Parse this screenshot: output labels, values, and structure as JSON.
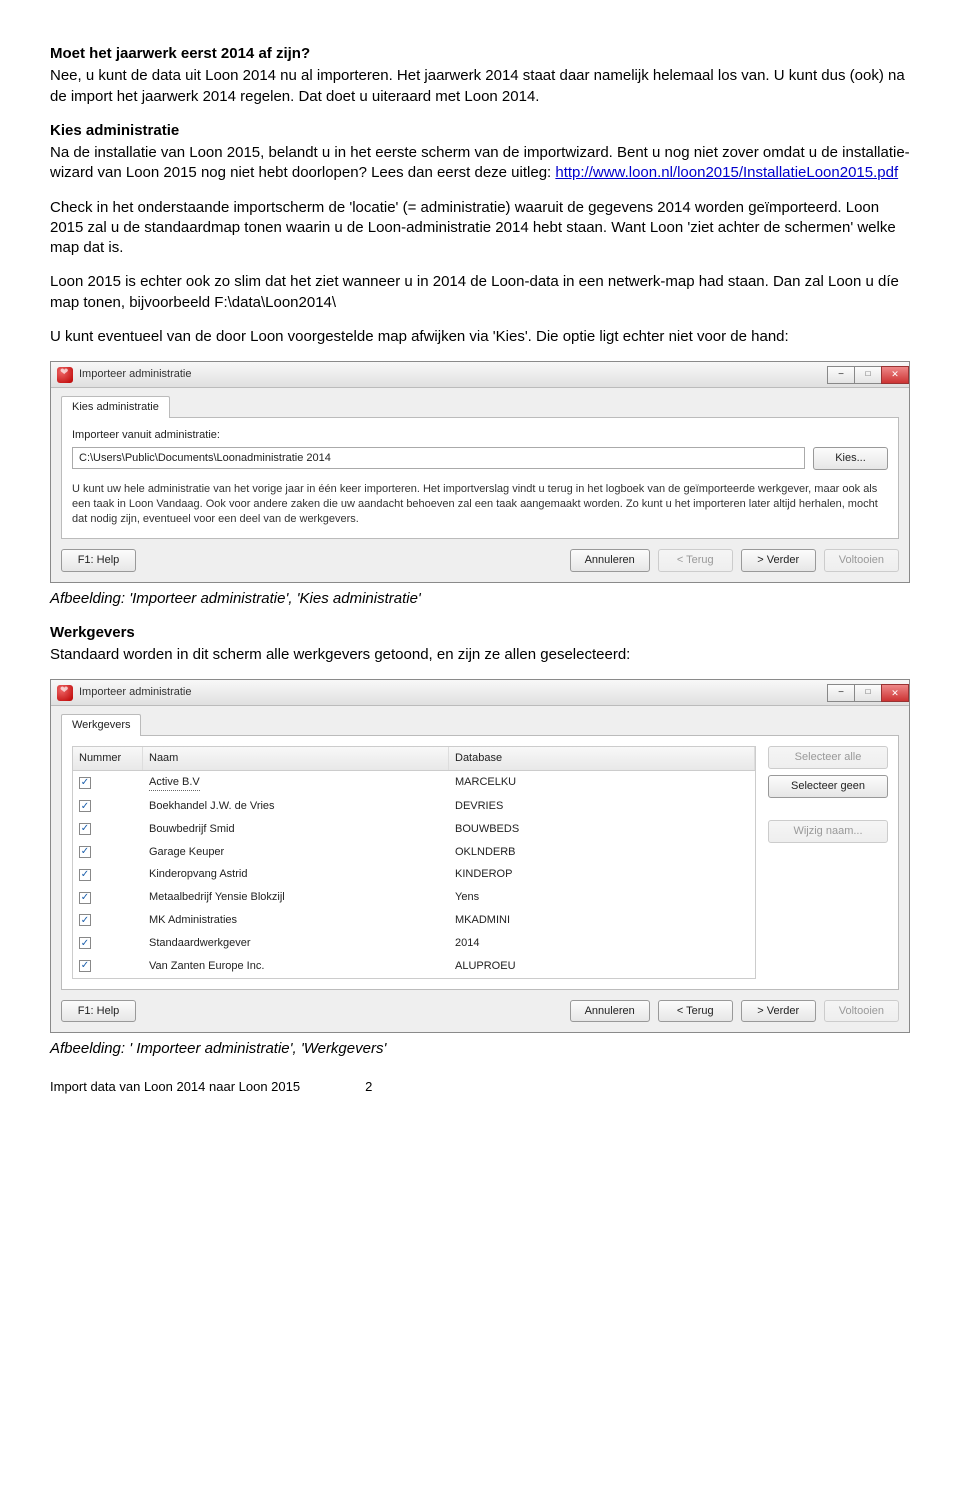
{
  "sec1": {
    "heading": "Moet het jaarwerk eerst 2014 af zijn?",
    "body": "Nee, u kunt de data uit Loon 2014 nu al importeren. Het jaarwerk 2014 staat daar namelijk helemaal los van. U kunt dus (ook) na de import het jaarwerk 2014 regelen. Dat doet u uiteraard met Loon 2014."
  },
  "sec2": {
    "heading": "Kies administratie",
    "body1": "Na de installatie van Loon 2015, belandt u in het eerste scherm van de importwizard. Bent u nog niet zover omdat u de installatie-wizard van Loon 2015 nog niet hebt doorlopen? Lees dan eerst deze uitleg: ",
    "link": "http://www.loon.nl/loon2015/InstallatieLoon2015.pdf",
    "body2": "Check in het onderstaande importscherm de 'locatie' (= administratie) waaruit de gegevens 2014 worden geïmporteerd. Loon 2015 zal u de standaardmap tonen waarin u de Loon-administratie 2014 hebt staan. Want Loon 'ziet achter de schermen' welke map dat is.",
    "body3": "Loon 2015 is echter ook zo slim dat het ziet wanneer u in 2014 de Loon-data in een netwerk-map had staan. Dan zal Loon u díe map tonen, bijvoorbeeld F:\\data\\Loon2014\\",
    "body4": "U kunt eventueel van de door Loon voorgestelde map afwijken via 'Kies'. Die optie ligt echter niet voor de hand:"
  },
  "dlg1": {
    "title": "Importeer administratie",
    "tab": "Kies administratie",
    "lblImport": "Importeer vanuit administratie:",
    "path": "C:\\Users\\Public\\Documents\\Loonadministratie 2014",
    "kies": "Kies...",
    "hint": "U kunt uw hele administratie van het vorige jaar in één keer importeren. Het importverslag vindt u terug in het logboek van de geïmporteerde werkgever, maar ook als een taak in Loon Vandaag. Ook voor andere zaken die uw aandacht behoeven zal een taak aangemaakt worden. Zo kunt u het importeren later altijd herhalen, mocht dat nodig zijn, eventueel voor een deel van de werkgevers.",
    "help": "F1: Help",
    "annuleren": "Annuleren",
    "terug": "< Terug",
    "verder": "> Verder",
    "voltooien": "Voltooien"
  },
  "caption1": "Afbeelding: 'Importeer administratie', 'Kies administratie'",
  "sec3": {
    "heading": "Werkgevers",
    "body": "Standaard worden in dit scherm alle werkgevers getoond, en zijn ze allen geselecteerd:"
  },
  "dlg2": {
    "title": "Importeer administratie",
    "tab": "Werkgevers",
    "colNummer": "Nummer",
    "colNaam": "Naam",
    "colDatabase": "Database",
    "selAlle": "Selecteer alle",
    "selGeen": "Selecteer geen",
    "wijzig": "Wijzig naam...",
    "help": "F1: Help",
    "annuleren": "Annuleren",
    "terug": "< Terug",
    "verder": "> Verder",
    "voltooien": "Voltooien",
    "rows": [
      {
        "naam": "Active B.V",
        "db": "MARCELKU"
      },
      {
        "naam": "Boekhandel J.W. de Vries",
        "db": "DEVRIES"
      },
      {
        "naam": "Bouwbedrijf Smid",
        "db": "BOUWBEDS"
      },
      {
        "naam": "Garage Keuper",
        "db": "OKLNDERB"
      },
      {
        "naam": "Kinderopvang Astrid",
        "db": "KINDEROP"
      },
      {
        "naam": "Metaalbedrijf Yensie Blokzijl",
        "db": "Yens"
      },
      {
        "naam": "MK Administraties",
        "db": "MKADMINI"
      },
      {
        "naam": "Standaardwerkgever",
        "db": "2014"
      },
      {
        "naam": "Van Zanten Europe Inc.",
        "db": "ALUPROEU"
      }
    ]
  },
  "caption2": "Afbeelding: ' Importeer administratie', 'Werkgevers'",
  "footer": {
    "left": "Import data van Loon 2014 naar Loon 2015",
    "page": "2"
  }
}
